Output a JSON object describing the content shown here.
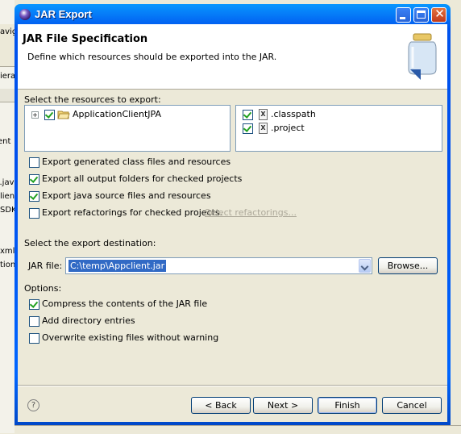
{
  "window": {
    "title": "JAR Export"
  },
  "header": {
    "title": "JAR File Specification",
    "description": "Define which resources should be exported into the JAR."
  },
  "resources": {
    "label": "Select the resources to export:",
    "projects": [
      {
        "name": "ApplicationClientJPA",
        "checked": true
      }
    ],
    "files": [
      {
        "name": ".classpath",
        "checked": true
      },
      {
        "name": ".project",
        "checked": true
      }
    ]
  },
  "export_options": [
    {
      "label": "Export generated class files and resources",
      "checked": false
    },
    {
      "label": "Export all output folders for checked projects",
      "checked": true
    },
    {
      "label": "Export java source files and resources",
      "checked": true
    },
    {
      "label": "Export refactorings for checked projects.",
      "checked": false
    }
  ],
  "select_refactorings_link": "Select refactorings...",
  "destination": {
    "label": "Select the export destination:",
    "jar_file_label": "JAR file:",
    "jar_file_value": "C:\\temp\\Appclient.jar",
    "browse_label": "Browse..."
  },
  "options": {
    "label": "Options:",
    "items": [
      {
        "label": "Compress the contents of the JAR file",
        "checked": true
      },
      {
        "label": "Add directory entries",
        "checked": false
      },
      {
        "label": "Overwrite existing files without warning",
        "checked": false
      }
    ]
  },
  "buttons": {
    "help": "?",
    "back": "< Back",
    "next": "Next >",
    "finish": "Finish",
    "cancel": "Cancel"
  },
  "background_fragments": [
    "avig",
    "iera",
    "ent",
    "c.jav",
    "lien",
    "SDK",
    "xml",
    "tion"
  ]
}
